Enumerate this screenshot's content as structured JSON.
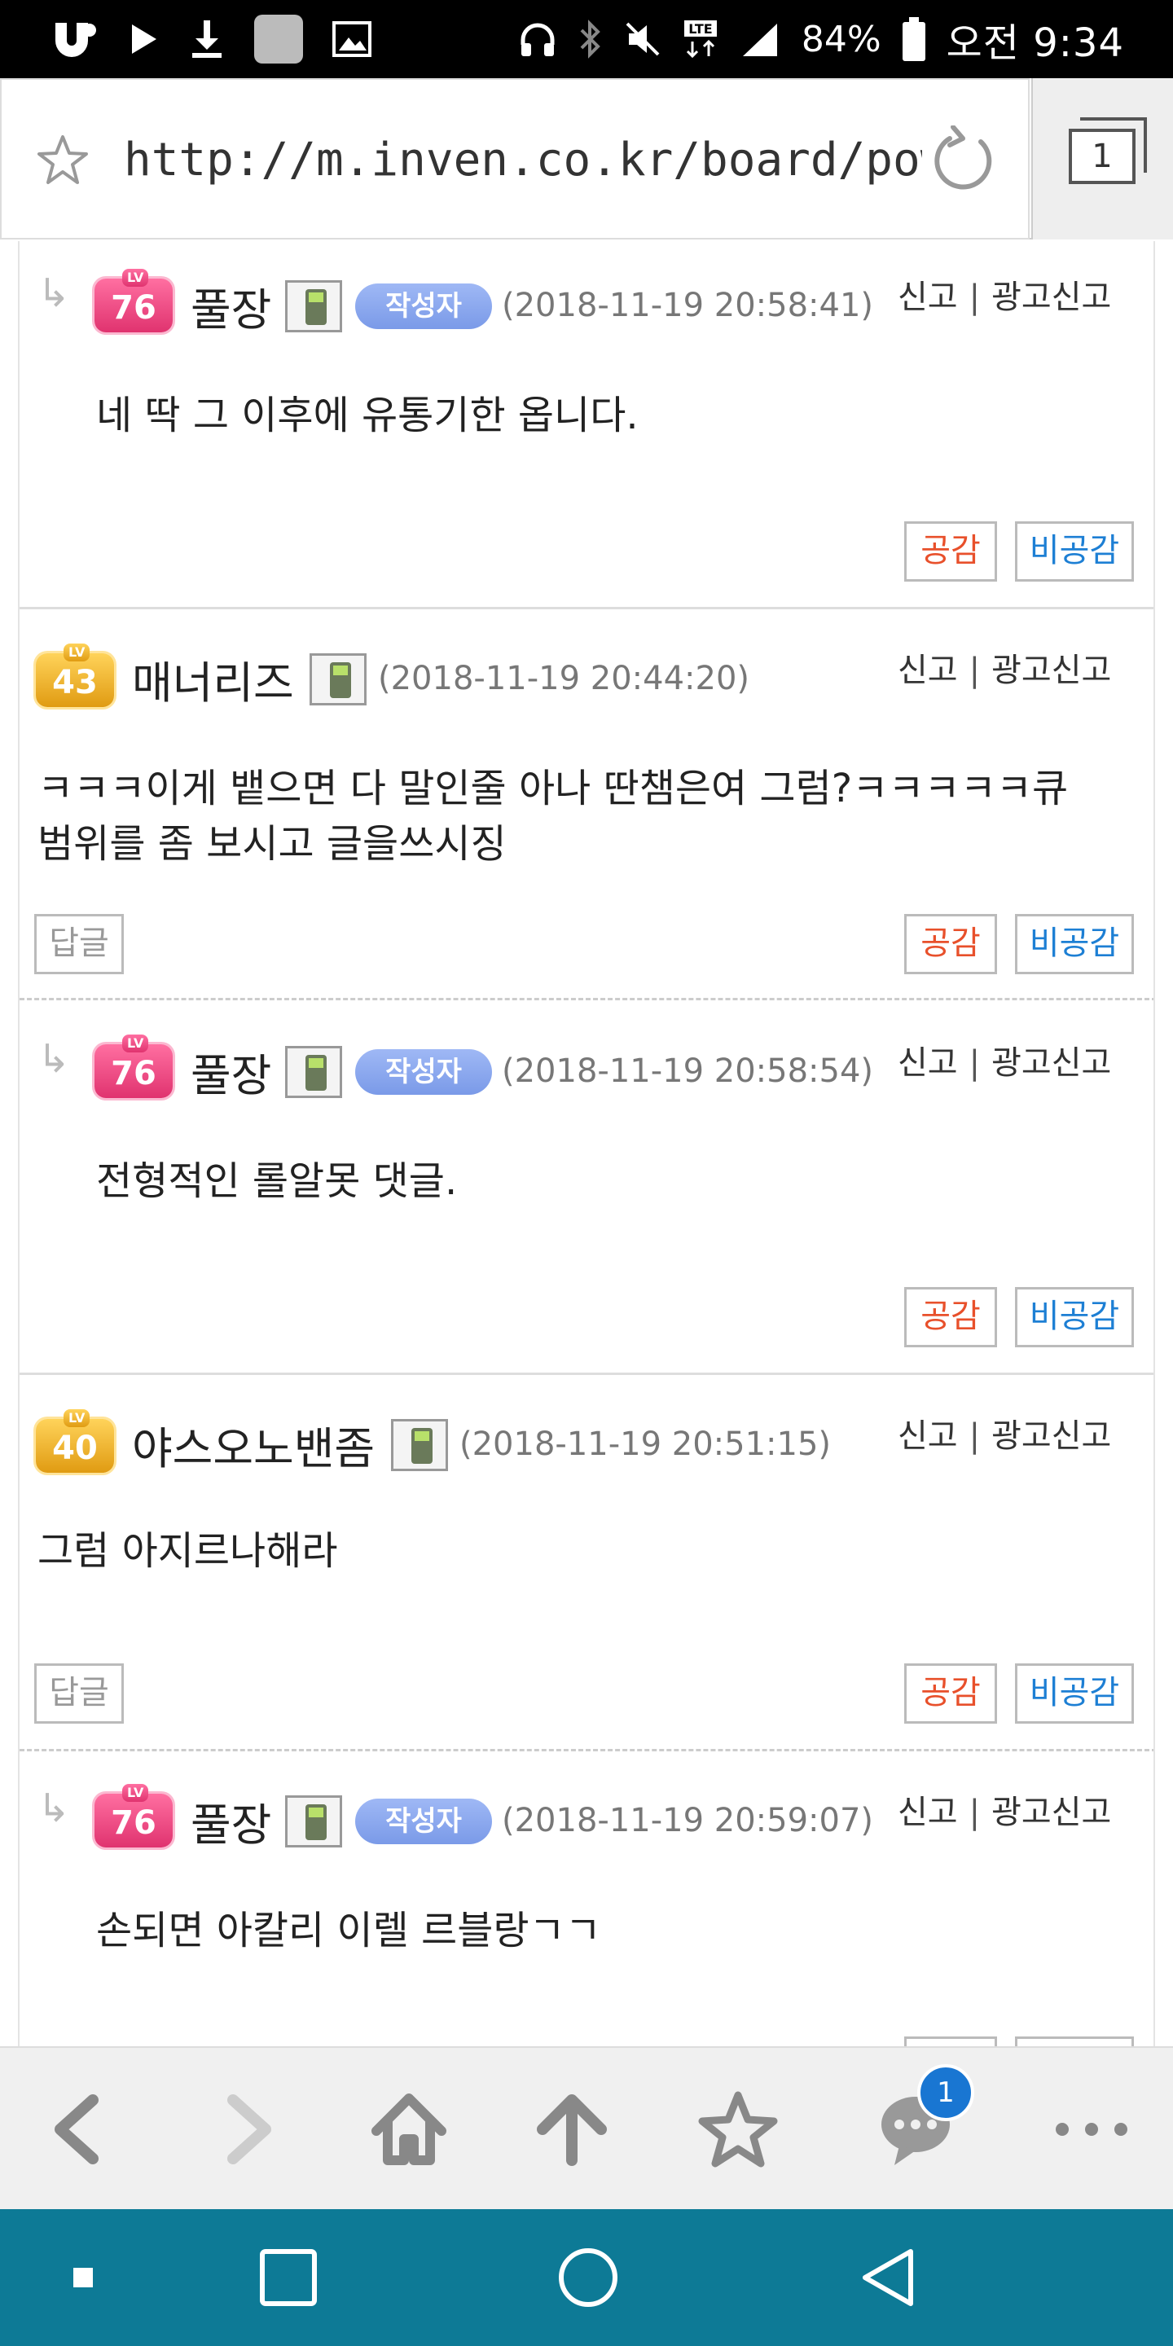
{
  "status_bar": {
    "icons": [
      "app-icon",
      "play-icon",
      "download-icon",
      "square-app-icon",
      "image-icon",
      "headphones-icon",
      "bluetooth-icon",
      "mute-icon",
      "lte-icon",
      "signal-icon",
      "battery-icon"
    ],
    "battery": "84%",
    "time": "오전 9:34"
  },
  "url_bar": {
    "url": "http://m.inven.co.kr/board/power",
    "tab_count": "1"
  },
  "common": {
    "report": "신고",
    "separator": "|",
    "ad_report": "광고신고",
    "like": "공감",
    "dislike": "비공감",
    "reply": "답글",
    "author_badge": "작성자",
    "reply_arrow": "↳"
  },
  "comments": [
    {
      "nick": "풀장",
      "level": "76",
      "lv_text": "LV",
      "date": "(2018-11-19 20:58:41)",
      "text": [
        "네 딱 그 이후에 유통기한 옵니다."
      ],
      "is_reply": true,
      "is_author": true
    },
    {
      "nick": "매너리즈",
      "level": "43",
      "lv_text": "LV",
      "date": "(2018-11-19 20:44:20)",
      "text": [
        "ㅋㅋㅋ이게 뱉으면 다 말인줄 아나 딴챔은여 그럼?ㅋㅋㅋㅋㅋ큐",
        "범위를 좀 보시고 글을쓰시징"
      ],
      "is_reply": false,
      "is_author": false
    },
    {
      "nick": "풀장",
      "level": "76",
      "lv_text": "LV",
      "date": "(2018-11-19 20:58:54)",
      "text": [
        "전형적인 롤알못 댓글."
      ],
      "is_reply": true,
      "is_author": true
    },
    {
      "nick": "야스오노밴좀",
      "level": "40",
      "lv_text": "LV",
      "date": "(2018-11-19 20:51:15)",
      "text": [
        "그럼 아지르나해라"
      ],
      "is_reply": false,
      "is_author": false
    },
    {
      "nick": "풀장",
      "level": "76",
      "lv_text": "LV",
      "date": "(2018-11-19 20:59:07)",
      "text": [
        "손되면 아칼리 이렐 르블랑ㄱㄱ"
      ],
      "is_reply": true,
      "is_author": true
    }
  ],
  "toolbar": {
    "items": [
      "back-icon",
      "forward-icon",
      "home-icon",
      "scroll-top-icon",
      "bookmark-icon",
      "chat-icon",
      "more-icon"
    ],
    "chat_badge": "1"
  },
  "navbar": {
    "items": [
      "recent-dot-icon",
      "overview-icon",
      "home-circle-icon",
      "back-triangle-icon"
    ]
  },
  "colors": {
    "nav_bg": "#0d7a96",
    "like": "#e8502b",
    "dislike": "#1d7fd4",
    "author_badge": "#7a9ae8",
    "badge_blue": "#1976d2"
  }
}
